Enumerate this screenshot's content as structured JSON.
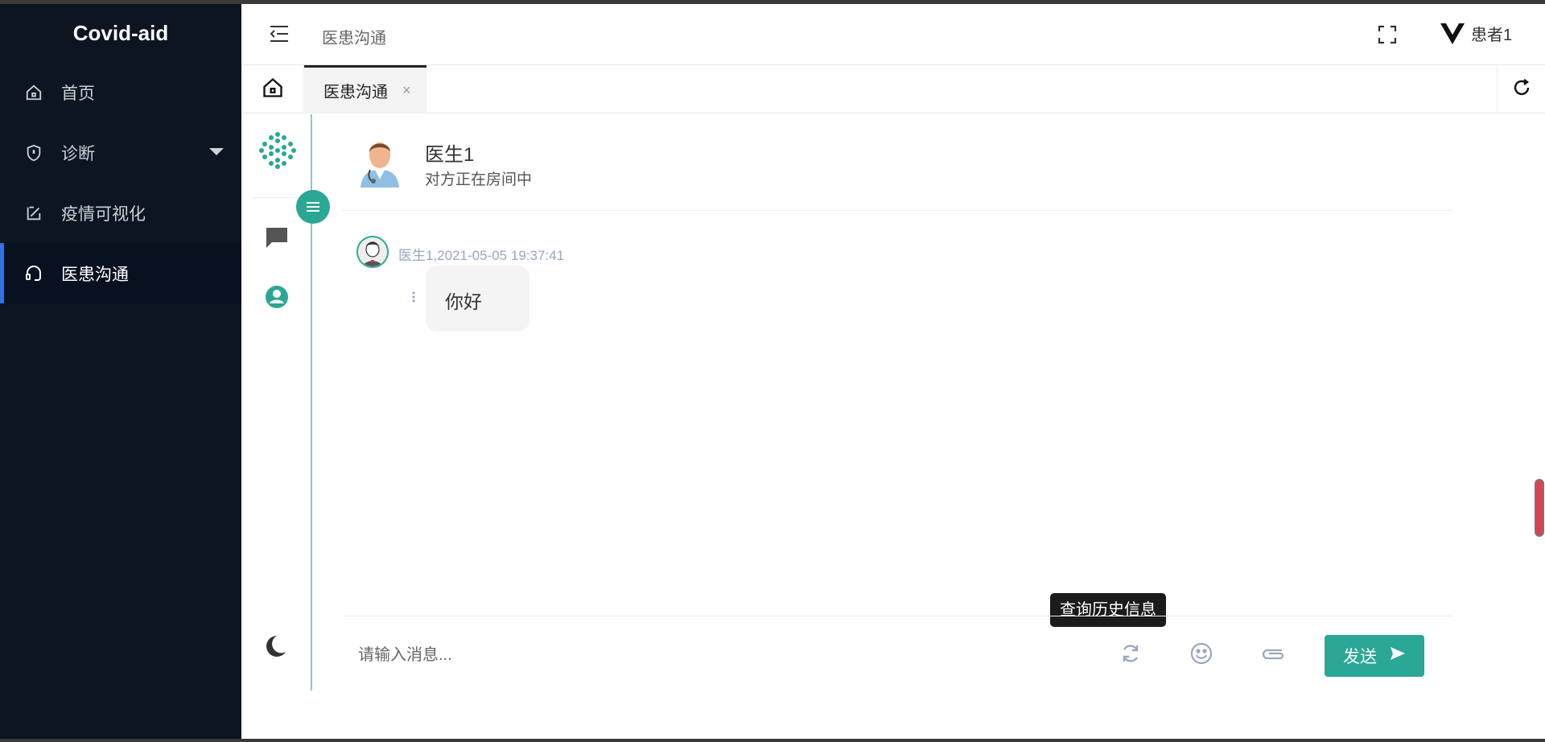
{
  "sidebar": {
    "brand": "Covid-aid",
    "items": [
      {
        "label": "首页",
        "icon": "home-icon"
      },
      {
        "label": "诊断",
        "icon": "shield-icon",
        "has_submenu": true
      },
      {
        "label": "疫情可视化",
        "icon": "chart-edit-icon"
      },
      {
        "label": "医患沟通",
        "icon": "headset-icon",
        "active": true
      }
    ]
  },
  "header": {
    "title": "医患沟通",
    "user_name": "患者1"
  },
  "tabs": {
    "items": [
      {
        "label": "医患沟通",
        "close": "×"
      }
    ]
  },
  "chat": {
    "contact_name": "医生1",
    "contact_status": "对方正在房间中",
    "messages": [
      {
        "meta": "医生1,2021-05-05 19:37:41",
        "text": "你好"
      }
    ],
    "input_placeholder": "请输入消息...",
    "tooltip": "查询历史信息",
    "send_label": "发送"
  },
  "colors": {
    "sidebar_bg": "#0d1521",
    "accent": "#2aa795",
    "active_indicator": "#2c73e6"
  }
}
